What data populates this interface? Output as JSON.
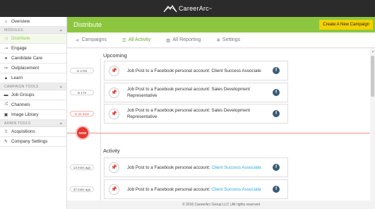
{
  "brand": {
    "name": "CareerArc",
    "mark": "™"
  },
  "sidebar": {
    "top_items": [
      {
        "label": "Overview",
        "icon": "home-icon"
      }
    ],
    "modules_header": "MODULES",
    "modules": [
      {
        "label": "Distribute",
        "icon": "share-icon",
        "active": true
      },
      {
        "label": "Engage",
        "icon": "engage-icon"
      },
      {
        "label": "Candidate Care",
        "icon": "user-icon"
      },
      {
        "label": "Outplacement",
        "icon": "outplacement-icon"
      },
      {
        "label": "Learn",
        "icon": "graduation-cap-icon"
      }
    ],
    "campaign_tools_header": "CAMPAIGN TOOLS",
    "campaign_tools": [
      {
        "label": "Job Groups",
        "icon": "briefcase-icon"
      },
      {
        "label": "Channels",
        "icon": "shuffle-icon"
      },
      {
        "label": "Image Library",
        "icon": "image-icon"
      }
    ],
    "admin_tools_header": "ADMIN TOOLS",
    "admin_tools": [
      {
        "label": "Acquisitions",
        "icon": "upload-icon"
      },
      {
        "label": "Company Settings",
        "icon": "wrench-icon"
      }
    ]
  },
  "header": {
    "title": "Distribute",
    "cta_label": "Create A New Campaign"
  },
  "tabs": [
    {
      "label": "Campaigns",
      "icon": "share-icon"
    },
    {
      "label": "All Activity",
      "icon": "list-icon",
      "active": true
    },
    {
      "label": "All Reporting",
      "icon": "chart-icon"
    },
    {
      "label": "Settings",
      "icon": "gear-icon"
    }
  ],
  "upcoming": {
    "title": "Upcoming",
    "items": [
      {
        "time": "in 2 hrs",
        "prefix": "Job Post to a Facebook personal account:",
        "job": "Client Success Associate"
      },
      {
        "time": "in 1 hr",
        "prefix": "Job Post to a Facebook personal account:",
        "job": "Sales Development Representative"
      },
      {
        "time": "in 20 mins",
        "prefix": "Job Post to a Facebook personal account:",
        "job": "Sales Development Representative"
      }
    ]
  },
  "now_label": "NOW",
  "activity": {
    "title": "Activity",
    "items": [
      {
        "time": "13 mins ago",
        "prefix": "Job Post to a Facebook personal account:",
        "job": "Client Success Associate"
      },
      {
        "time": "37 mins ago",
        "prefix": "Job Post to a Facebook personal account:",
        "job": "Client Success Associate"
      }
    ]
  },
  "social_icon_label": "f",
  "footer": {
    "text": "© 2016 CareerArc Group LLC  |  All rights reserved"
  },
  "colors": {
    "accent_green": "#8cc63f",
    "cta_yellow": "#f5d100",
    "now_red": "#e8372e",
    "link_blue": "#2fa9d6",
    "facebook": "#3b5a78"
  }
}
